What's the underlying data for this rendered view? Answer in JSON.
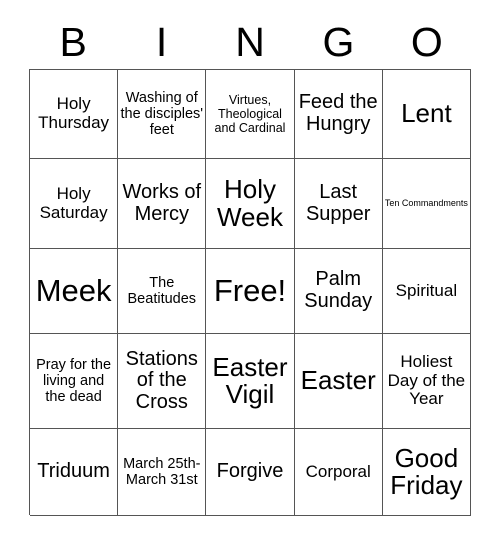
{
  "card": {
    "type": "bingo-card",
    "header_letters": [
      "B",
      "I",
      "N",
      "G",
      "O"
    ],
    "columns": 5,
    "rows": 5,
    "colors": {
      "background": "#ffffff",
      "text": "#000000",
      "grid_line": "#555555"
    },
    "free_space": {
      "row": 3,
      "column": 3,
      "label": "Free!"
    },
    "cells": [
      [
        {
          "text": "Holy Thursday",
          "size": "lg"
        },
        {
          "text": "Washing of the disciples' feet",
          "size": "md"
        },
        {
          "text": "Virtues, Theological and Cardinal",
          "size": "sm"
        },
        {
          "text": "Feed the Hungry",
          "size": "xl"
        },
        {
          "text": "Lent",
          "size": "xxl"
        }
      ],
      [
        {
          "text": "Holy Saturday",
          "size": "lg"
        },
        {
          "text": "Works of Mercy",
          "size": "xl"
        },
        {
          "text": "Holy Week",
          "size": "xxl"
        },
        {
          "text": "Last Supper",
          "size": "xl"
        },
        {
          "text": "Ten Commandments",
          "size": "xs"
        }
      ],
      [
        {
          "text": "Meek",
          "size": "hug"
        },
        {
          "text": "The Beatitudes",
          "size": "md"
        },
        {
          "text": "Free!",
          "size": "hug"
        },
        {
          "text": "Palm Sunday",
          "size": "xl"
        },
        {
          "text": "Spiritual",
          "size": "lg"
        }
      ],
      [
        {
          "text": "Pray for the living and the dead",
          "size": "md"
        },
        {
          "text": "Stations of the Cross",
          "size": "xl"
        },
        {
          "text": "Easter Vigil",
          "size": "xxl"
        },
        {
          "text": "Easter",
          "size": "xxl"
        },
        {
          "text": "Holiest Day of the Year",
          "size": "lg"
        }
      ],
      [
        {
          "text": "Triduum",
          "size": "xl"
        },
        {
          "text": "March 25th-March 31st",
          "size": "md"
        },
        {
          "text": "Forgive",
          "size": "xl"
        },
        {
          "text": "Corporal",
          "size": "lg"
        },
        {
          "text": "Good Friday",
          "size": "xxl"
        }
      ]
    ]
  }
}
